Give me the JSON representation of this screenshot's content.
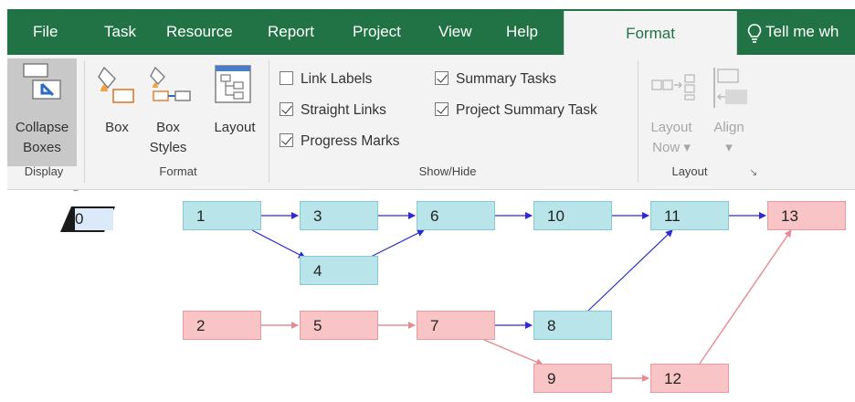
{
  "tabs": {
    "file": "File",
    "task": "Task",
    "resource": "Resource",
    "report": "Report",
    "project": "Project",
    "view": "View",
    "help": "Help",
    "format": "Format",
    "tell_me": "Tell me wh"
  },
  "ribbon": {
    "display": {
      "collapse_line1": "Collapse",
      "collapse_line2": "Boxes",
      "label": "Display"
    },
    "format": {
      "box": "Box",
      "box_styles_line1": "Box",
      "box_styles_line2": "Styles",
      "layout": "Layout",
      "label": "Format"
    },
    "show_hide": {
      "link_labels": "Link Labels",
      "straight_links": "Straight Links",
      "progress_marks": "Progress Marks",
      "summary_tasks": "Summary Tasks",
      "project_summary_task": "Project Summary Task",
      "label": "Show/Hide",
      "checked": {
        "link_labels": false,
        "straight_links": true,
        "progress_marks": true,
        "summary_tasks": true,
        "project_summary_task": true
      }
    },
    "layout_group": {
      "layout_now_line1": "Layout",
      "layout_now_line2": "Now",
      "align_line1": "Align",
      "label": "Layout"
    }
  },
  "diagram": {
    "summary_node": "0",
    "nodes": [
      {
        "id": "1",
        "critical": false
      },
      {
        "id": "3",
        "critical": false
      },
      {
        "id": "4",
        "critical": false
      },
      {
        "id": "6",
        "critical": false
      },
      {
        "id": "10",
        "critical": false
      },
      {
        "id": "11",
        "critical": false
      },
      {
        "id": "13",
        "critical": true
      },
      {
        "id": "2",
        "critical": true
      },
      {
        "id": "5",
        "critical": true
      },
      {
        "id": "7",
        "critical": true
      },
      {
        "id": "8",
        "critical": false
      },
      {
        "id": "9",
        "critical": true
      },
      {
        "id": "12",
        "critical": true
      }
    ],
    "colors": {
      "normal_fill": "#b9e4e9",
      "critical_fill": "#f8c4c6",
      "normal_link": "#2a2ad6",
      "critical_link": "#e88a8e",
      "tab_green": "#217346"
    }
  }
}
